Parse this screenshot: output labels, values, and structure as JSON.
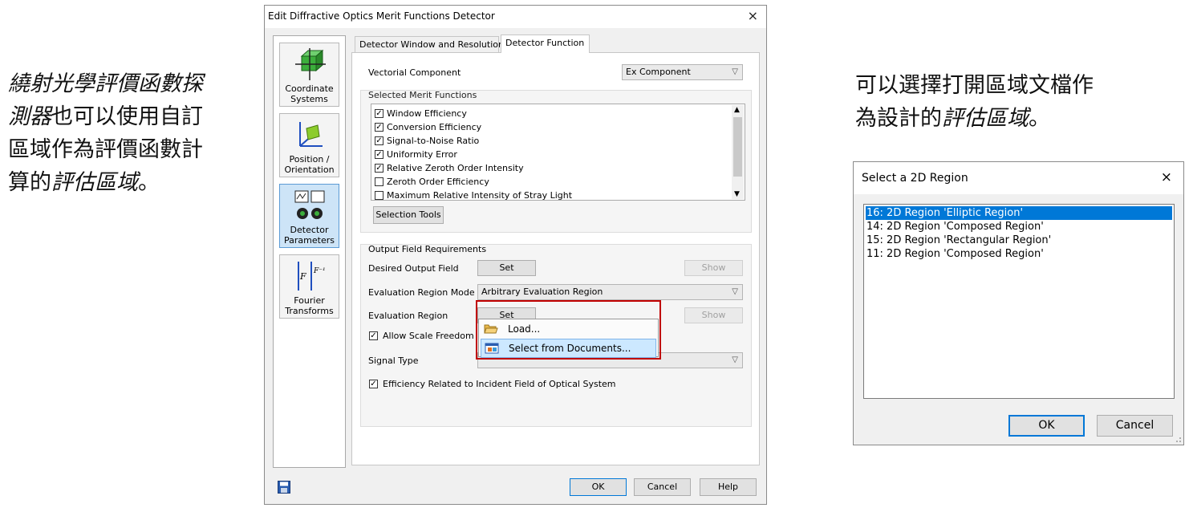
{
  "left_caption": {
    "lines": [
      {
        "parts": [
          {
            "text": "繞射光學評價函數探",
            "italic": true
          }
        ]
      },
      {
        "parts": [
          {
            "text": "測器",
            "italic": true
          },
          {
            "text": "也可以使用自訂",
            "italic": false
          }
        ]
      },
      {
        "parts": [
          {
            "text": "區域作為評價函數計",
            "italic": false
          }
        ]
      },
      {
        "parts": [
          {
            "text": "算的",
            "italic": false
          },
          {
            "text": "評估區域",
            "italic": true
          },
          {
            "text": "。",
            "italic": false
          }
        ]
      }
    ]
  },
  "right_caption": {
    "lines": [
      {
        "parts": [
          {
            "text": "可以選擇打開區域文檔作",
            "italic": false
          }
        ]
      },
      {
        "parts": [
          {
            "text": "為設計的",
            "italic": false
          },
          {
            "text": "評估區域",
            "italic": true
          },
          {
            "text": "。",
            "italic": false
          }
        ]
      }
    ]
  },
  "main_dialog": {
    "title": "Edit Diffractive Optics Merit Functions Detector",
    "close": "×",
    "sidebar": [
      {
        "label": "Coordinate Systems",
        "icon": "coordinate-systems-icon",
        "selected": false
      },
      {
        "label": "Position / Orientation",
        "icon": "position-orientation-icon",
        "selected": false
      },
      {
        "label": "Detector Parameters",
        "icon": "detector-parameters-icon",
        "selected": true
      },
      {
        "label": "Fourier Transforms",
        "icon": "fourier-transforms-icon",
        "selected": false
      }
    ],
    "tabs": [
      {
        "label": "Detector Window and Resolution",
        "active": false
      },
      {
        "label": "Detector Function",
        "active": true
      }
    ],
    "vectorial_component_label": "Vectorial Component",
    "vectorial_component_value": "Ex Component",
    "selected_merit_functions_label": "Selected Merit Functions",
    "merit_functions": [
      {
        "label": "Window Efficiency",
        "checked": true
      },
      {
        "label": "Conversion Efficiency",
        "checked": true
      },
      {
        "label": "Signal-to-Noise Ratio",
        "checked": true
      },
      {
        "label": "Uniformity Error",
        "checked": true
      },
      {
        "label": "Relative Zeroth Order Intensity",
        "checked": true
      },
      {
        "label": "Zeroth Order Efficiency",
        "checked": false
      },
      {
        "label": "Maximum Relative Intensity of Stray Light",
        "checked": false
      }
    ],
    "selection_tools": "Selection Tools",
    "output_field_requirements": "Output Field Requirements",
    "desired_output_field_label": "Desired Output Field",
    "set_label": "Set",
    "show_label": "Show",
    "evaluation_region_mode_label": "Evaluation Region Mode",
    "evaluation_region_mode_value": "Arbitrary Evaluation Region",
    "evaluation_region_label": "Evaluation Region",
    "allow_scale_freedom": "Allow Scale Freedom",
    "allow_scale_freedom_checked": true,
    "signal_type_label": "Signal Type",
    "efficiency_related": "Efficiency Related to Incident Field of Optical System",
    "efficiency_related_checked": true,
    "popup_menu": {
      "items": [
        {
          "label": "Load...",
          "icon": "folder-open-icon",
          "highlighted": false
        },
        {
          "label": "Select from Documents...",
          "icon": "documents-icon",
          "highlighted": true
        }
      ],
      "highlight_color": "#c00000"
    },
    "footer": {
      "ok": "OK",
      "cancel": "Cancel",
      "help": "Help",
      "save_icon": "save-icon"
    }
  },
  "region_dialog": {
    "title": "Select a 2D Region",
    "close": "×",
    "items": [
      {
        "label": "16: 2D Region 'Elliptic Region'",
        "selected": true
      },
      {
        "label": "14: 2D Region 'Composed Region'",
        "selected": false
      },
      {
        "label": "15: 2D Region 'Rectangular Region'",
        "selected": false
      },
      {
        "label": "11: 2D Region 'Composed Region'",
        "selected": false
      }
    ],
    "ok": "OK",
    "cancel": "Cancel",
    "selection_color": "#0078d7"
  }
}
